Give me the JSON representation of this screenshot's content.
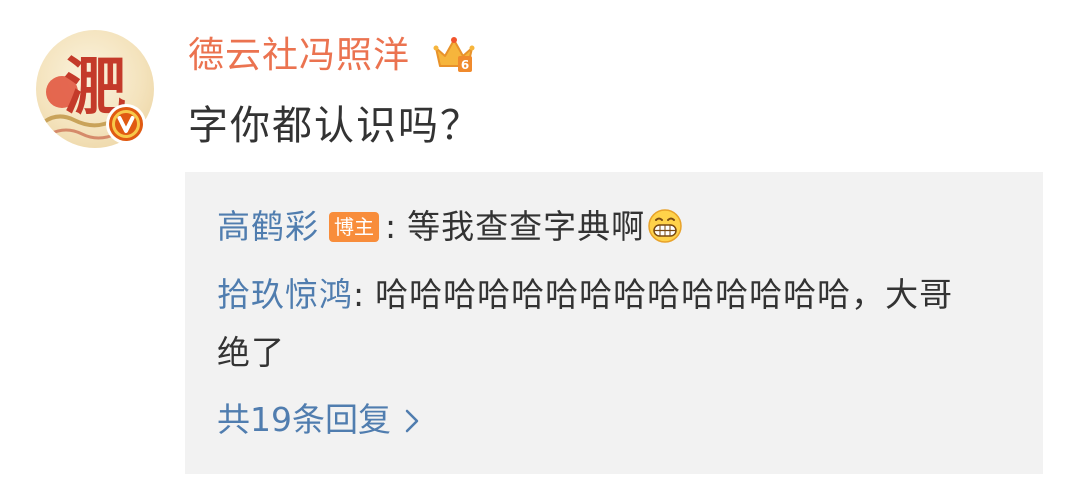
{
  "comment": {
    "username": "德云社冯照洋",
    "text": "字你都认识吗？",
    "avatar_char": "淝",
    "badge_icon": "crown-vip-icon",
    "verified_icon": "verified-v-icon"
  },
  "replies": [
    {
      "name": "高鹤彩",
      "tag": "博主",
      "separator": ":",
      "text": "等我查查字典啊",
      "emoji": "grin-emoji-icon"
    },
    {
      "name": "拾玖惊鸿",
      "separator": ":",
      "text": "哈哈哈哈哈哈哈哈哈哈哈哈哈哈，大哥绝了"
    }
  ],
  "more_replies": {
    "label": "共19条回复"
  },
  "colors": {
    "username": "#eb7350",
    "link": "#507daf",
    "text": "#333333",
    "reply_bg": "#f2f2f2",
    "tag_bg": "#f88d3b",
    "verified": "#e05a12"
  }
}
